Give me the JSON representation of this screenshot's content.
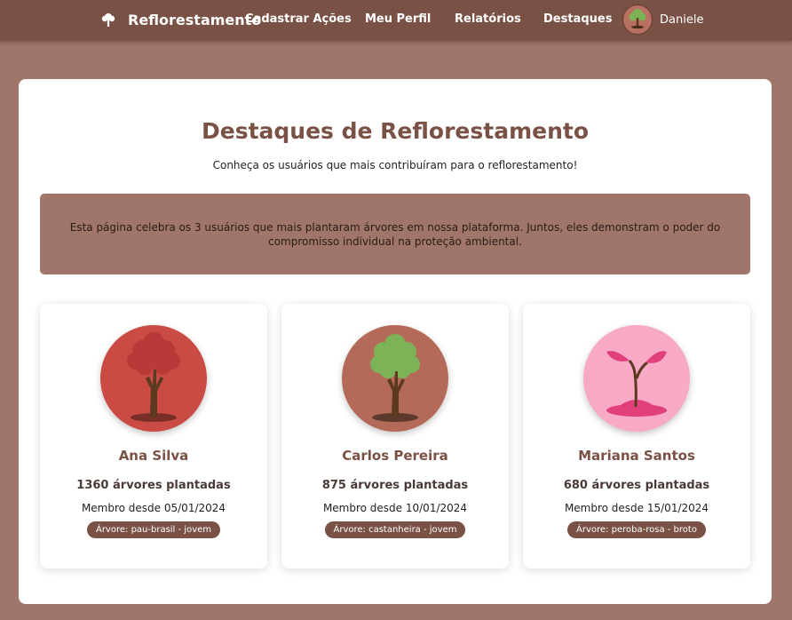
{
  "nav": {
    "brand": "Reflorestamento",
    "links": [
      "Cadastrar Ações",
      "Meu Perfil",
      "Relatórios",
      "Destaques"
    ],
    "user_name": "Daniele",
    "brand_icon": "tree-icon",
    "avatar_icon": "green-tree-icon"
  },
  "page": {
    "title": "Destaques de Reflorestamento",
    "subtitle": "Conheça os usuários que mais contribuíram para o reflorestamento!",
    "info": "Esta página celebra os 3 usuários que mais plantaram árvores em nossa plataforma. Juntos, eles demonstram o poder do compromisso individual na proteção ambiental."
  },
  "users": [
    {
      "name": "Ana Silva",
      "trees": "1360 árvores plantadas",
      "since": "Membro desde 05/01/2024",
      "badge": "Árvore: pau-brasil - jovem",
      "icon": "red-tree-icon",
      "color": "#c94b43"
    },
    {
      "name": "Carlos Pereira",
      "trees": "875 árvores plantadas",
      "since": "Membro desde 10/01/2024",
      "badge": "Árvore: castanheira - jovem",
      "icon": "green-tree-icon",
      "color": "#b46a58"
    },
    {
      "name": "Mariana Santos",
      "trees": "680 árvores plantadas",
      "since": "Membro desde 15/01/2024",
      "badge": "Árvore: peroba-rosa - broto",
      "icon": "sprout-icon",
      "color": "#f8a9c6"
    }
  ],
  "colors": {
    "primary": "#7a5145",
    "background": "#a1766a",
    "card": "#ffffff"
  }
}
